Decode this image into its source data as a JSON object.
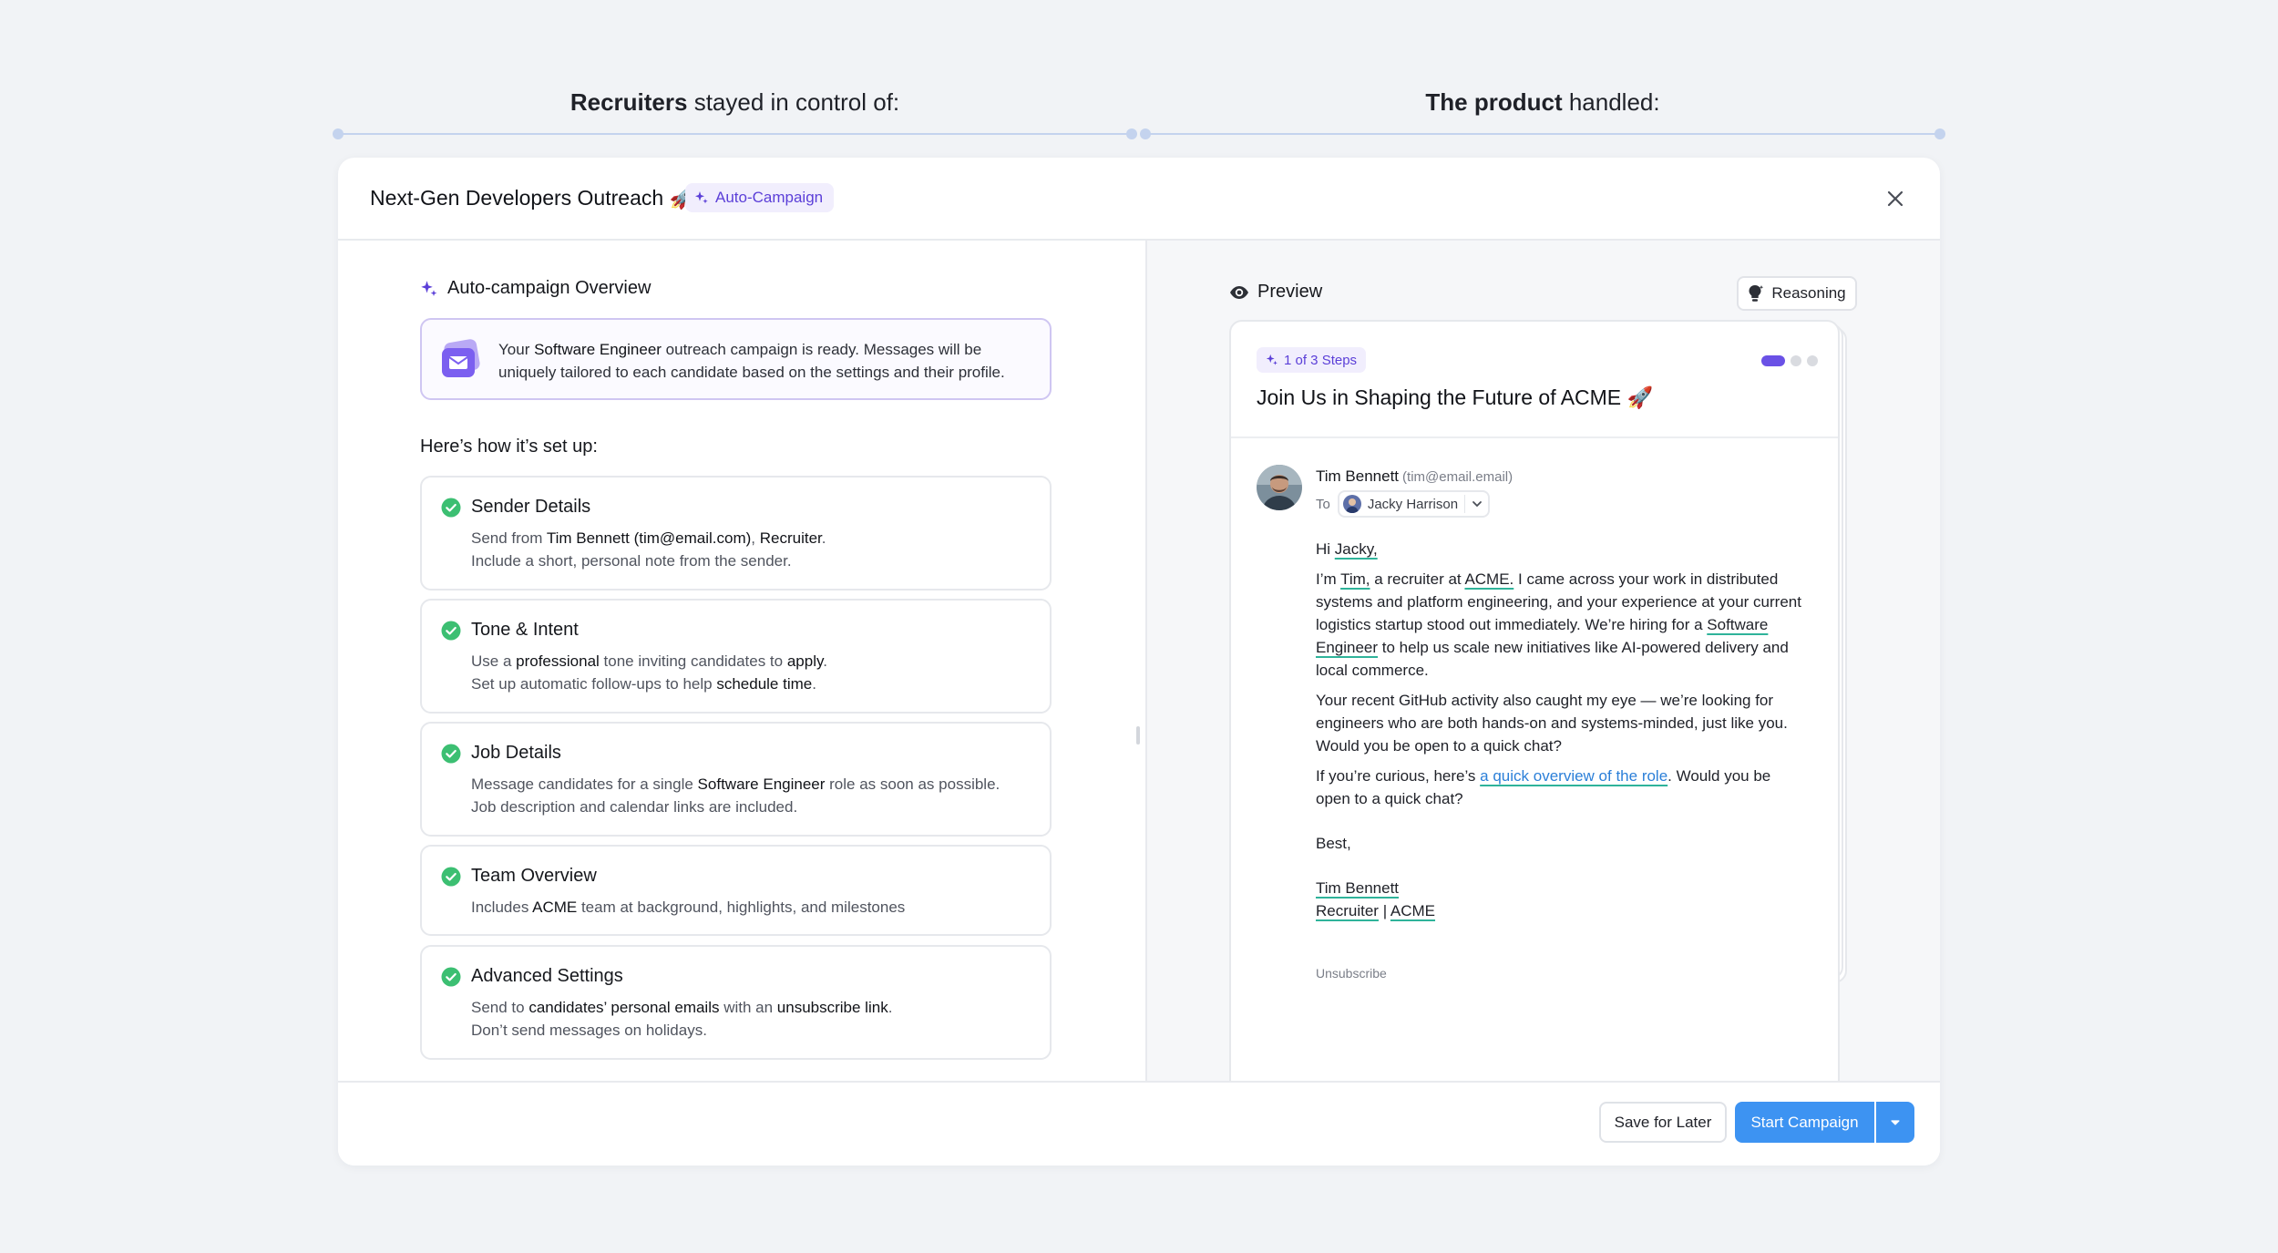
{
  "annotations": {
    "left": {
      "bold": "Recruiters",
      "rest": " stayed in control of:"
    },
    "right": {
      "bold": "The product",
      "rest": " handled:"
    }
  },
  "modal": {
    "title": "Next-Gen Developers Outreach 🚀",
    "badge": "Auto-Campaign"
  },
  "overview": {
    "title": "Auto-campaign Overview",
    "ready_pre": "Your ",
    "ready_role": "Software Engineer",
    "ready_post": " outreach campaign is ready. Messages will be uniquely tailored to each candidate based on the settings and their profile.",
    "setup_title": "Here’s how it’s set up:"
  },
  "cards": [
    {
      "title": "Sender Details",
      "l1a": "Send from ",
      "l1b": "Tim Bennett (tim@email.com)",
      "l1c": ", ",
      "l1d": "Recruiter",
      "l1e": ".",
      "l2": "Include a short, personal note from the sender."
    },
    {
      "title": "Tone & Intent",
      "l1a": "Use a ",
      "l1b": "professional",
      "l1c": " tone inviting candidates to ",
      "l1d": "apply",
      "l1e": ".",
      "l2a": "Set up automatic follow-ups to help ",
      "l2b": "schedule time",
      "l2c": "."
    },
    {
      "title": "Job Details",
      "l1a": "Message candidates for a single ",
      "l1b": "Software Engineer",
      "l1c": " role as soon as possible.",
      "l2": "Job description and calendar links are included."
    },
    {
      "title": "Team Overview",
      "l1a": "Includes ",
      "l1b": "ACME",
      "l1c": " team at background, highlights, and milestones"
    },
    {
      "title": "Advanced Settings",
      "l1a": "Send to ",
      "l1b": "candidates’ personal emails",
      "l1c": " with an ",
      "l1d": "unsubscribe link",
      "l1e": ".",
      "l2": "Don’t send messages on holidays."
    }
  ],
  "preview": {
    "label": "Preview",
    "reasoning": "Reasoning",
    "steps": "1 of 3 Steps",
    "subject": "Join Us in Shaping the Future of ACME 🚀",
    "sender_name": "Tim Bennett",
    "sender_email": "(tim@email.email)",
    "to_label": "To",
    "recipient": "Jacky Harrison",
    "greeting_pre": "Hi ",
    "greeting_name": "Jacky,",
    "p1_a": "I’m ",
    "p1_name": "Tim,",
    "p1_b": " a recruiter at ",
    "p1_company": "ACME.",
    "p1_c": " I came across your work in distributed systems and platform engineering, and your experience at your current logistics startup stood out immediately. We’re hiring for a ",
    "p1_role": "Software Engineer",
    "p1_d": " to help us scale new initiatives like AI-powered delivery and local commerce.",
    "p2": "Your recent GitHub activity also caught my eye — we’re looking for engineers who are both hands-on and systems-minded, just like you. Would you be open to a quick chat?",
    "p3_a": "If you’re curious, here’s ",
    "p3_link": "a quick overview of the role",
    "p3_b": ". Would you be open to a quick chat?",
    "signoff": "Best,",
    "sig_name": "Tim Bennett",
    "sig_title": "Recruiter",
    "sig_sep": " | ",
    "sig_company": "ACME",
    "unsubscribe": "Unsubscribe"
  },
  "footer": {
    "save": "Save for Later",
    "start": "Start Campaign"
  },
  "colors": {
    "accent_purple": "#5b3fd8",
    "primary_blue": "#3d93f2",
    "success_green": "#3cbf72",
    "highlight_teal": "#2fb39a",
    "link_blue": "#2b7fd8"
  },
  "icons": [
    "sparkle-icon",
    "close-icon",
    "mail-icon",
    "check-circle-icon",
    "eye-icon",
    "lightbulb-icon",
    "chevron-down-icon",
    "caret-down-icon"
  ]
}
